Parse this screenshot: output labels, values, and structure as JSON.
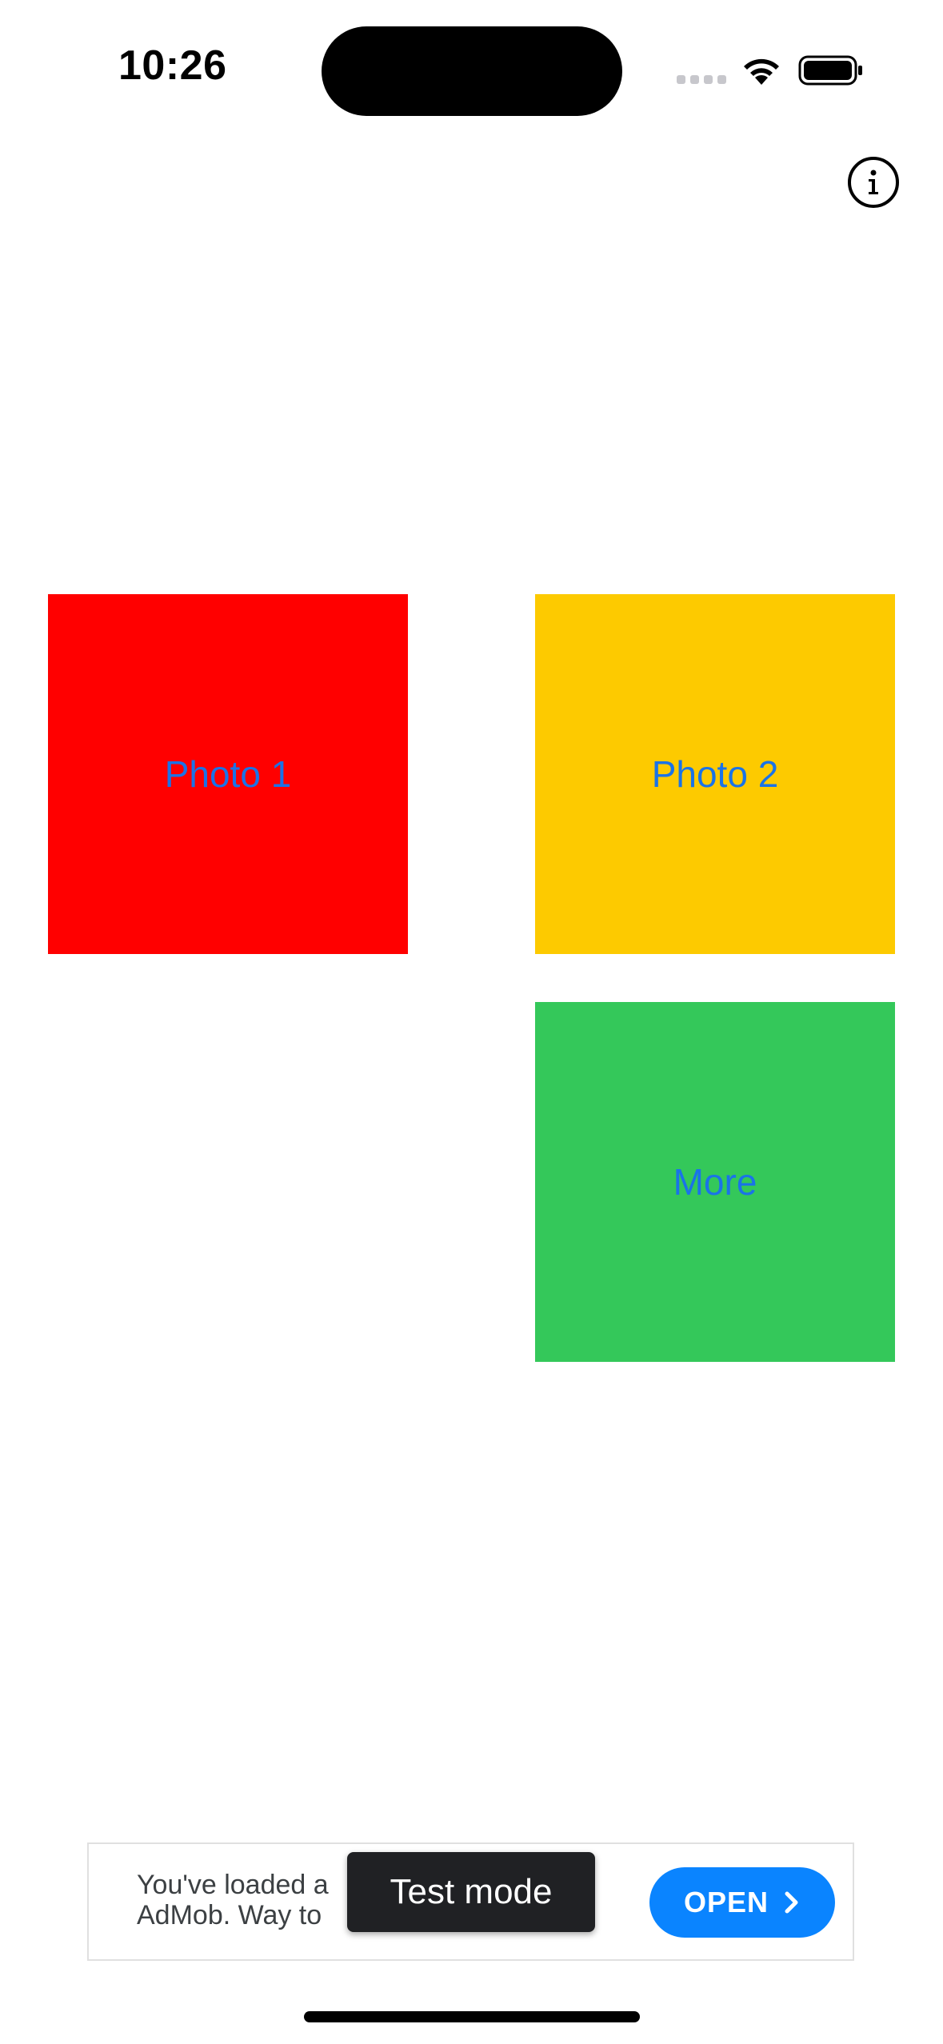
{
  "status_bar": {
    "time": "10:26",
    "icons": [
      "signal-icon",
      "wifi-icon",
      "battery-icon"
    ]
  },
  "header": {
    "info_icon": "info-icon"
  },
  "tiles": [
    {
      "label": "Photo 1",
      "color": "#ff0000"
    },
    {
      "label": "Photo 2",
      "color": "#fdca00"
    },
    {
      "label": "More",
      "color": "#34c85a"
    }
  ],
  "tile_label_color": "#1a73e8",
  "ad": {
    "text_line1": "You've loaded a",
    "text_line2": "AdMob. Way to",
    "test_mode_label": "Test mode",
    "open_label": "OPEN",
    "open_button_color": "#0a84ff",
    "open_icon": "chevron-right-icon"
  }
}
